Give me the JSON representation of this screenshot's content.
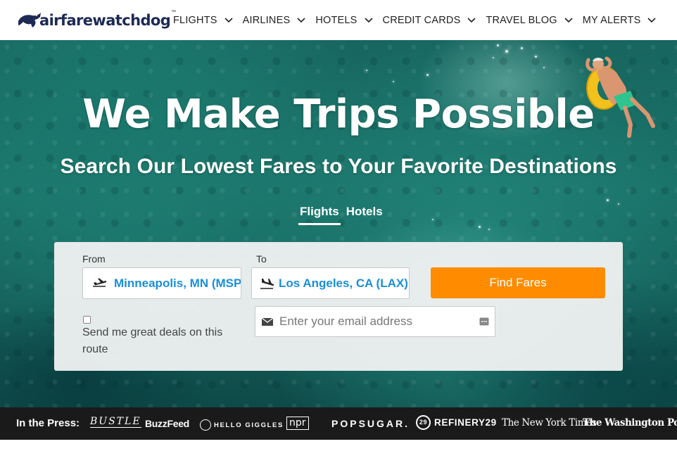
{
  "brand": {
    "name": "airfarewatchdog",
    "trademark": "™"
  },
  "nav": {
    "items": [
      {
        "label": "FLIGHTS"
      },
      {
        "label": "AIRLINES"
      },
      {
        "label": "HOTELS"
      },
      {
        "label": "CREDIT CARDS"
      },
      {
        "label": "TRAVEL BLOG"
      },
      {
        "label": "MY ALERTS"
      }
    ]
  },
  "hero": {
    "headline": "We Make Trips Possible",
    "subheadline": "Search Our Lowest Fares to Your Favorite Destinations"
  },
  "tabs": [
    {
      "label": "Flights",
      "active": true
    },
    {
      "label": "Hotels",
      "active": false
    }
  ],
  "search": {
    "from_label": "From",
    "from_value": "Minneapolis, MN (MSP",
    "to_label": "To",
    "to_value": "Los Angeles, CA (LAX)",
    "find_button": "Find Fares",
    "deals_checkbox_label": "Send me great deals on this route",
    "deals_checked": false,
    "email_placeholder": "Enter your email address"
  },
  "press": {
    "label": "In the Press:",
    "logos": [
      {
        "name": "BUSTLE"
      },
      {
        "name": "BuzzFeed"
      },
      {
        "name": "HELLO GIGGLES"
      },
      {
        "name": "npr"
      },
      {
        "name": "POPSUGAR."
      },
      {
        "name": "REFINERY29"
      },
      {
        "name": "The New York Times"
      },
      {
        "name": "The Washington Post"
      }
    ]
  },
  "colors": {
    "accent_orange": "#ff8c00",
    "link_blue": "#1a8fd8",
    "logo_navy": "#1d2a55",
    "press_bar": "#1a1a1a"
  },
  "icons": {
    "from": "plane-takeoff-icon",
    "to": "plane-landing-icon",
    "email": "envelope-icon",
    "menu_chevron": "chevron-down-icon"
  }
}
